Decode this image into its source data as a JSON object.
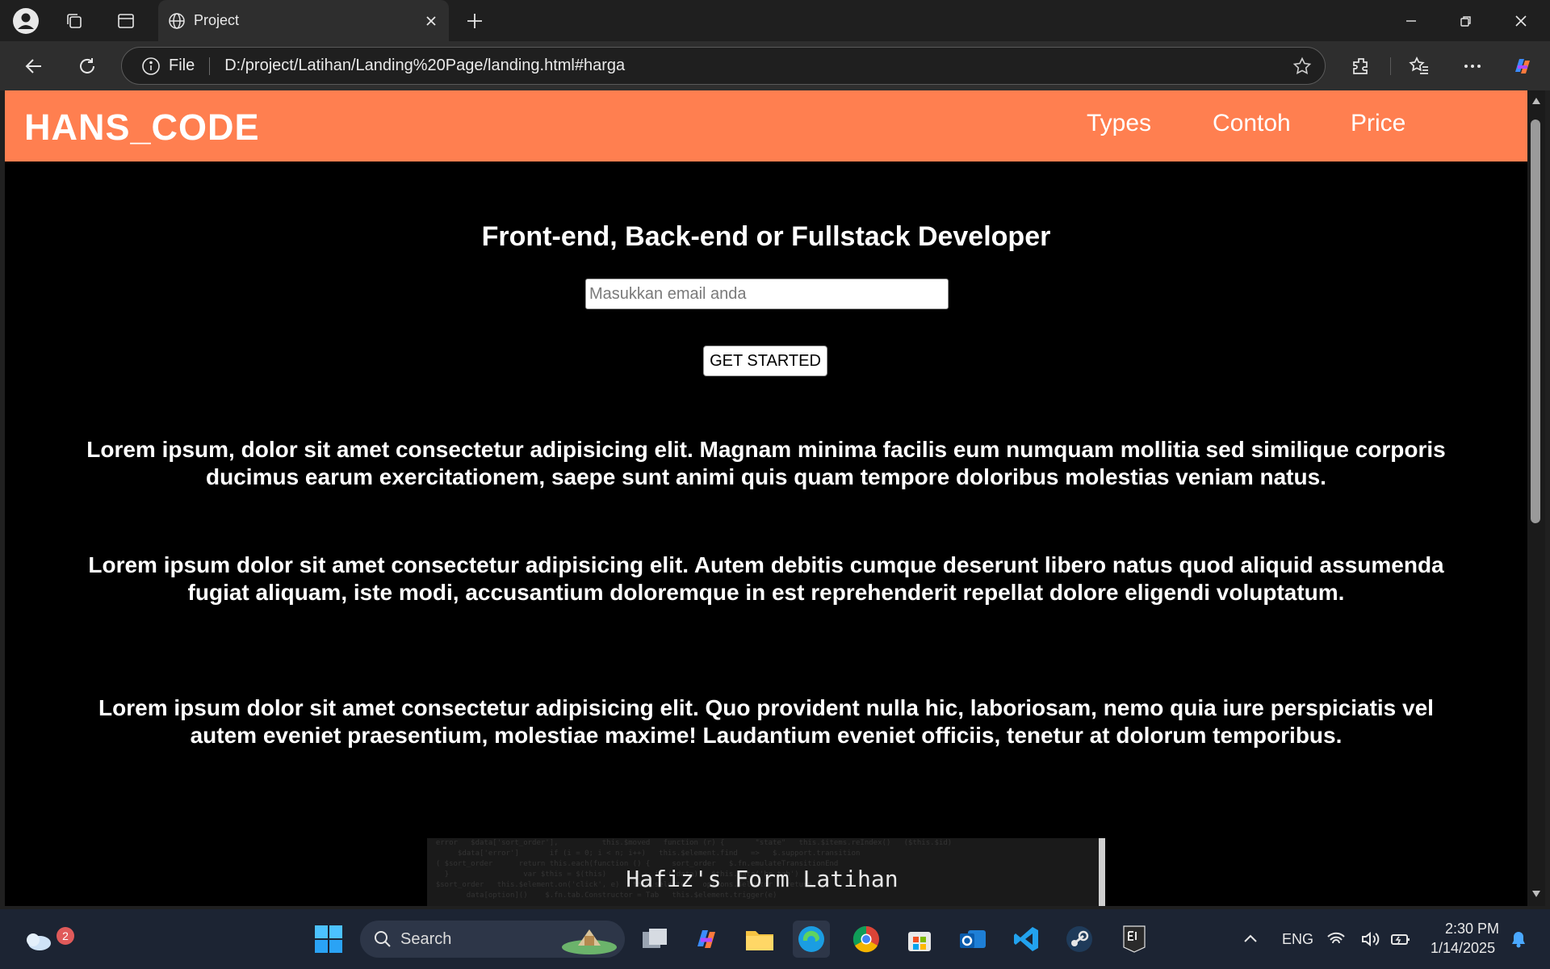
{
  "browser": {
    "tab_title": "Project",
    "omnibox": {
      "scheme_label": "File",
      "url": "D:/project/Latihan/Landing%20Page/landing.html#harga"
    }
  },
  "page": {
    "brand": "HANS_CODE",
    "nav": [
      "Types",
      "Contoh",
      "Price"
    ],
    "hero_title": "Front-end, Back-end or Fullstack Developer",
    "email_placeholder": "Masukkan email anda",
    "cta_label": "GET STARTED",
    "paragraphs": [
      "Lorem ipsum, dolor sit amet consectetur adipisicing elit. Magnam minima facilis eum numquam mollitia sed similique corporis ducimus earum exercitationem, saepe sunt animi quis quam tempore doloribus molestias veniam natus.",
      "Lorem ipsum dolor sit amet consectetur adipisicing elit. Autem debitis cumque deserunt libero natus quod aliquid assumenda fugiat aliquam, iste modi, accusantium doloremque in est reprehenderit repellat dolore eligendi voluptatum.",
      "Lorem ipsum dolor sit amet consectetur adipisicing elit. Quo provident nulla hic, laboriosam, nemo quia iure perspiciatis vel autem eveniet praesentium, molestiae maxime! Laudantium eveniet officiis, tenetur at dolorum temporibus."
    ],
    "form_preview_title": "Hafiz's Form Latihan"
  },
  "taskbar": {
    "weather_badge": "2",
    "search_label": "Search",
    "language": "ENG",
    "time": "2:30 PM",
    "date": "1/14/2025"
  },
  "colors": {
    "header_bg": "#ff7f50",
    "page_bg": "#000000",
    "taskbar_bg": "#1c2433"
  }
}
